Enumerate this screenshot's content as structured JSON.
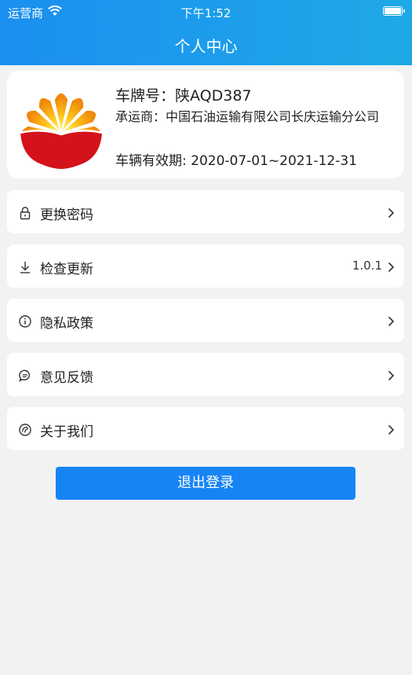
{
  "status_bar": {
    "carrier": "运营商",
    "time": "下午1:52"
  },
  "nav": {
    "title": "个人中心"
  },
  "profile": {
    "plate": "车牌号：陕AQD387",
    "carrier": "承运商：中国石油运输有限公司长庆运输分公司",
    "validity": "车辆有效期: 2020-07-01~2021-12-31"
  },
  "menu": [
    {
      "label": "更换密码",
      "icon": "lock-icon"
    },
    {
      "label": "检查更新",
      "icon": "download-icon",
      "value": "1.0.1"
    },
    {
      "label": "隐私政策",
      "icon": "info-icon"
    },
    {
      "label": "意见反馈",
      "icon": "feedback-icon"
    },
    {
      "label": "关于我们",
      "icon": "about-icon"
    }
  ],
  "logout_label": "退出登录",
  "colors": {
    "header": "#1b8ff0",
    "button": "#1784f5",
    "background": "#f2f2f2"
  }
}
